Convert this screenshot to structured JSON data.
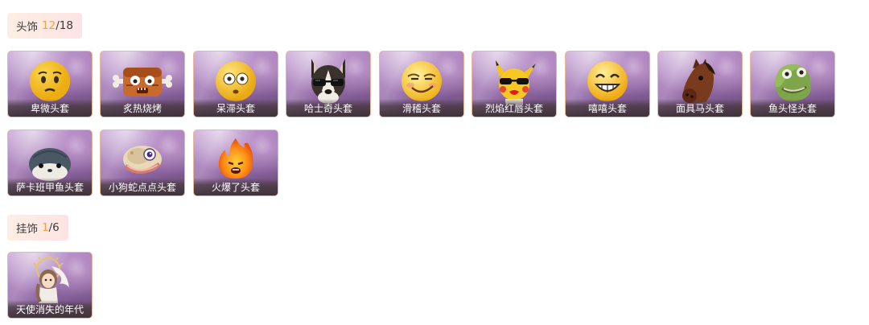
{
  "headwear": {
    "title": "头饰",
    "owned": "12",
    "total": "/18",
    "items": [
      {
        "name": "卑微头套",
        "icon": "worried-emoji-head-icon"
      },
      {
        "name": "炙热烧烤",
        "icon": "bbq-meat-head-icon"
      },
      {
        "name": "呆滞头套",
        "icon": "dazed-emoji-head-icon"
      },
      {
        "name": "哈士奇头套",
        "icon": "husky-sunglasses-head-icon"
      },
      {
        "name": "滑稽头套",
        "icon": "funny-emoji-head-icon"
      },
      {
        "name": "烈焰红唇头套",
        "icon": "pikachu-red-lips-head-icon"
      },
      {
        "name": "嘻嘻头套",
        "icon": "grinning-emoji-head-icon"
      },
      {
        "name": "面具马头套",
        "icon": "horse-mask-head-icon"
      },
      {
        "name": "鱼头怪头套",
        "icon": "fish-monster-head-icon"
      },
      {
        "name": "萨卡班甲鱼头套",
        "icon": "sacabambaspis-head-icon"
      },
      {
        "name": "小狗蛇点点头套",
        "icon": "dog-snake-head-icon"
      },
      {
        "name": "火爆了头套",
        "icon": "fire-head-icon"
      }
    ]
  },
  "pendant": {
    "title": "挂饰",
    "owned": "1",
    "total": "/6",
    "items": [
      {
        "name": "天使消失的年代",
        "icon": "angel-doll-pendant-icon"
      }
    ]
  },
  "colors": {
    "accent_count": "#f0a04a",
    "card_border": "#e6b99a",
    "card_bg": "#a176b5"
  }
}
